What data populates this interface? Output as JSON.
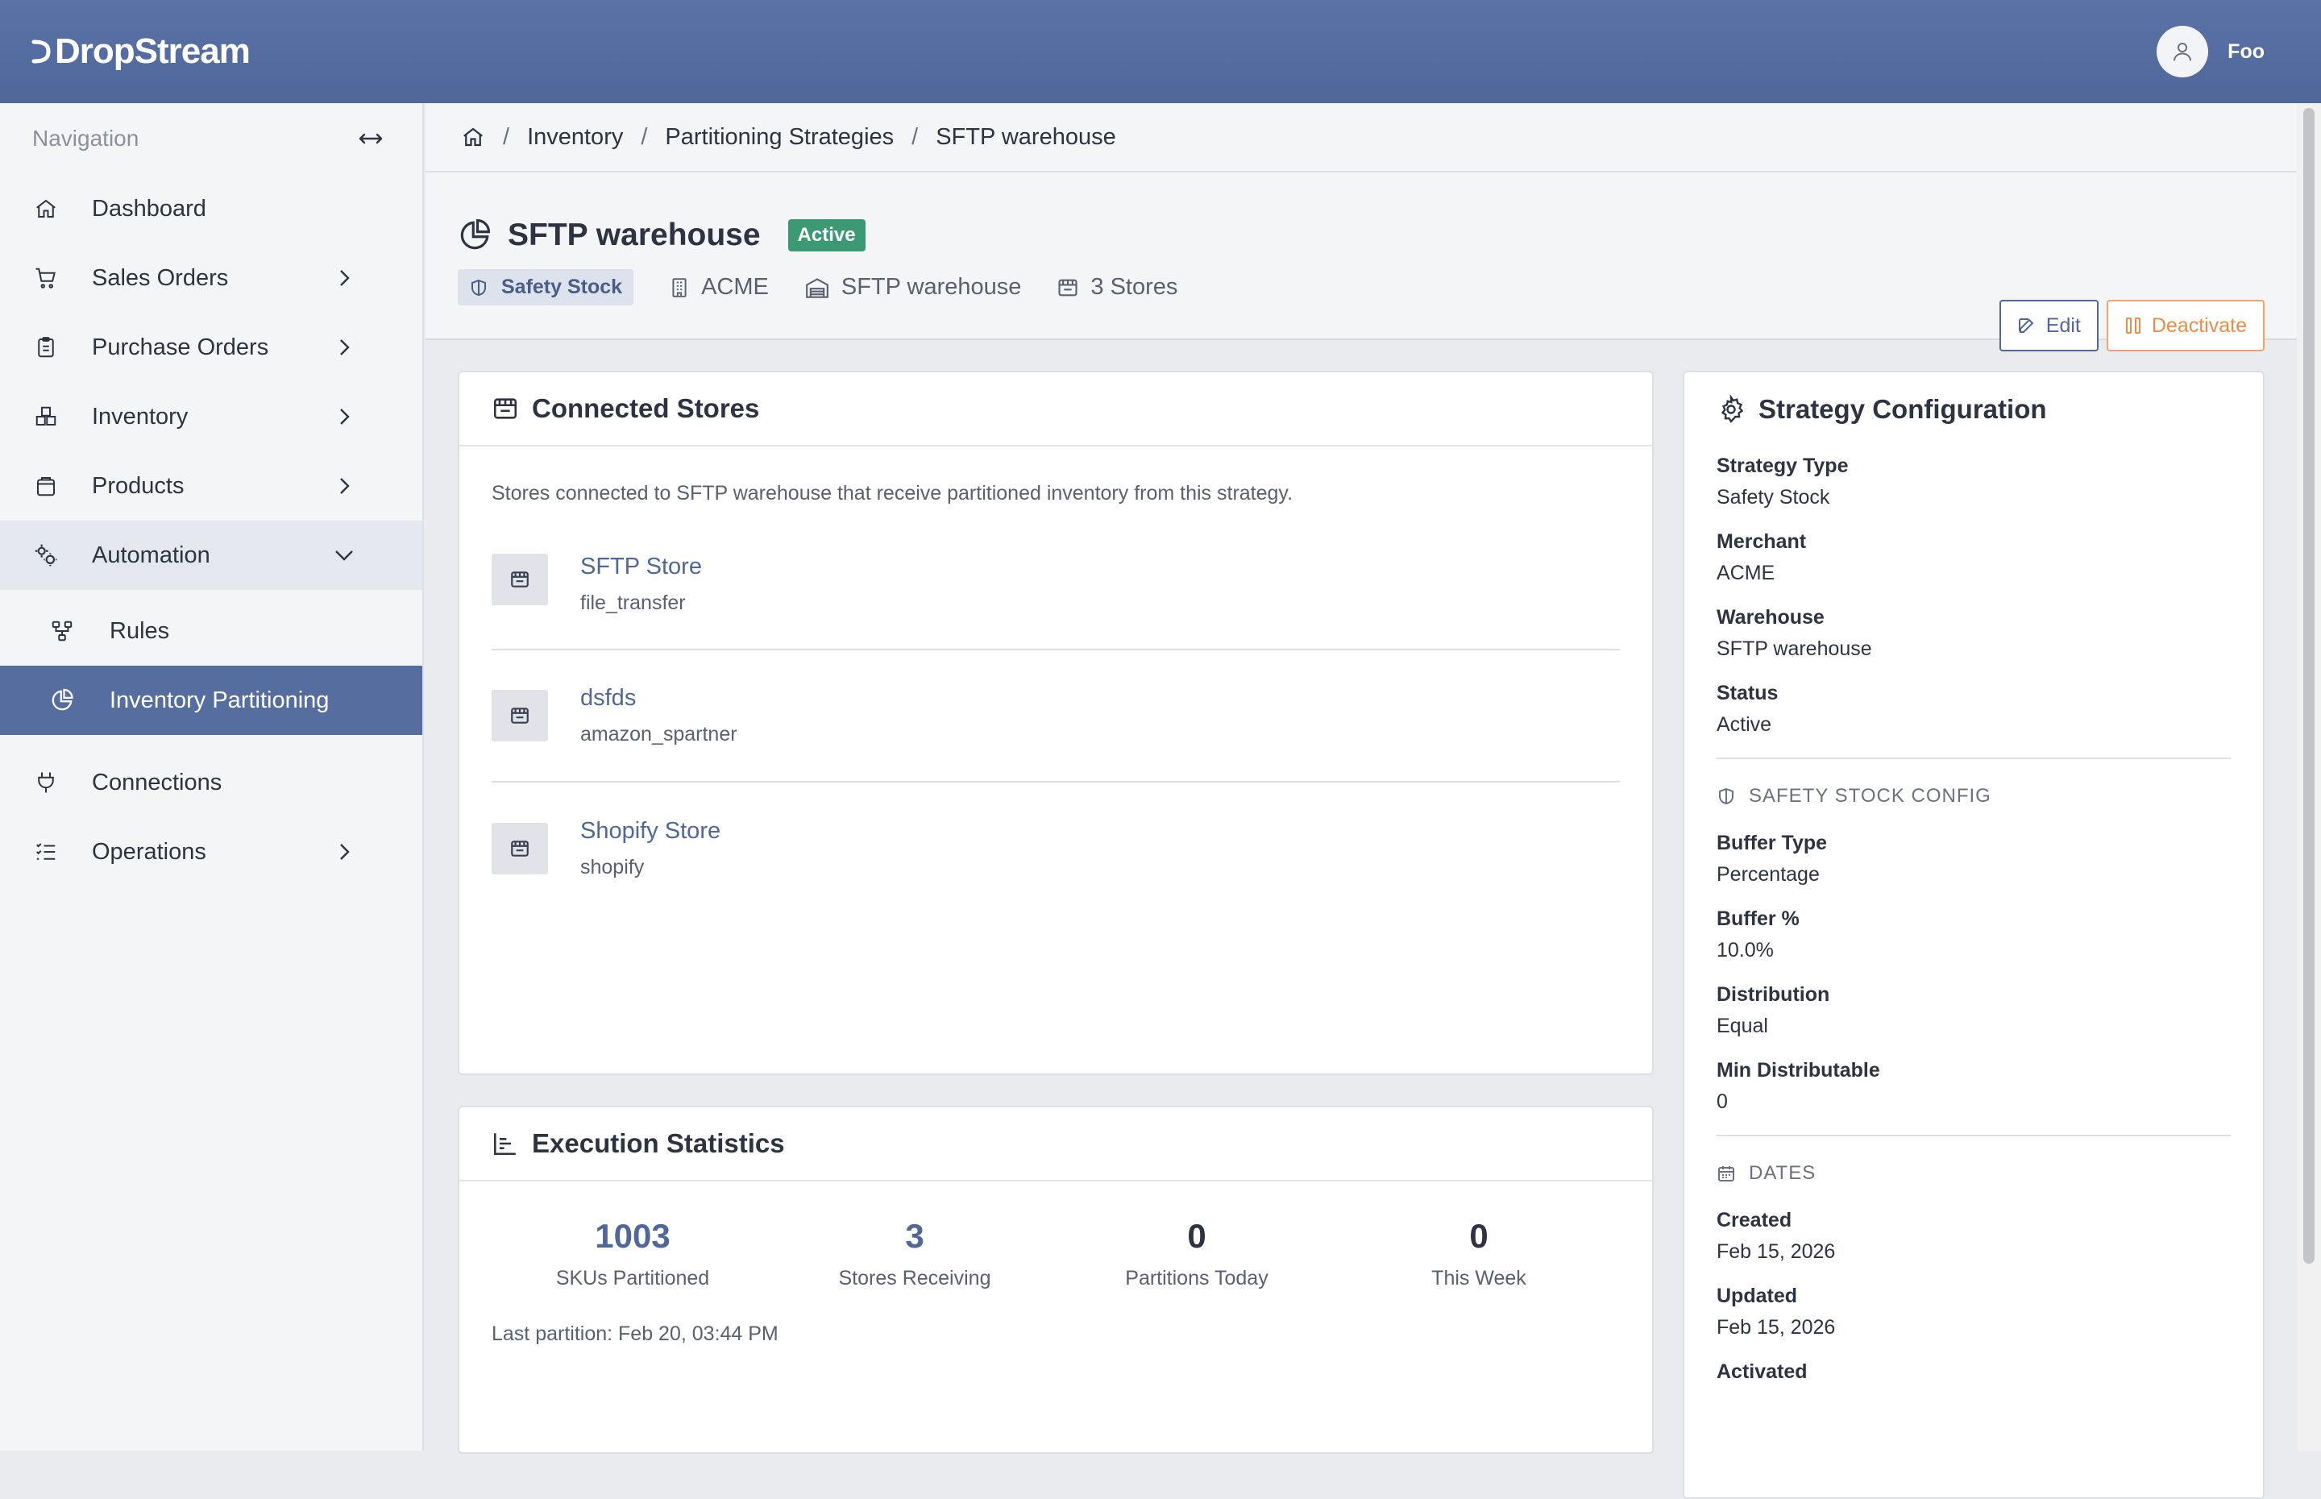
{
  "app": {
    "name": "DropStream"
  },
  "user": {
    "name": "Foo"
  },
  "sidebar": {
    "title": "Navigation",
    "items": [
      {
        "label": "Dashboard"
      },
      {
        "label": "Sales Orders"
      },
      {
        "label": "Purchase Orders"
      },
      {
        "label": "Inventory"
      },
      {
        "label": "Products"
      },
      {
        "label": "Automation"
      },
      {
        "label": "Connections"
      },
      {
        "label": "Operations"
      }
    ],
    "automation_children": [
      {
        "label": "Rules"
      },
      {
        "label": "Inventory Partitioning"
      }
    ]
  },
  "breadcrumb": [
    "Inventory",
    "Partitioning Strategies",
    "SFTP warehouse"
  ],
  "header": {
    "title": "SFTP warehouse",
    "status": "Active",
    "tag": "Safety Stock",
    "merchant": "ACME",
    "warehouse": "SFTP warehouse",
    "stores": "3 Stores",
    "edit_label": "Edit",
    "deactivate_label": "Deactivate"
  },
  "connected_stores": {
    "title": "Connected Stores",
    "description": "Stores connected to SFTP warehouse that receive partitioned inventory from this strategy.",
    "stores": [
      {
        "name": "SFTP Store",
        "type": "file_transfer"
      },
      {
        "name": "dsfds",
        "type": "amazon_spartner"
      },
      {
        "name": "Shopify Store",
        "type": "shopify"
      }
    ]
  },
  "stats": {
    "title": "Execution Statistics",
    "items": [
      {
        "value": "1003",
        "label": "SKUs Partitioned"
      },
      {
        "value": "3",
        "label": "Stores Receiving"
      },
      {
        "value": "0",
        "label": "Partitions Today"
      },
      {
        "value": "0",
        "label": "This Week"
      }
    ],
    "last_partition": "Last partition: Feb 20, 03:44 PM"
  },
  "config": {
    "title": "Strategy Configuration",
    "fields": [
      {
        "label": "Strategy Type",
        "value": "Safety Stock"
      },
      {
        "label": "Merchant",
        "value": "ACME"
      },
      {
        "label": "Warehouse",
        "value": "SFTP warehouse"
      },
      {
        "label": "Status",
        "value": "Active"
      }
    ],
    "safety_section": "SAFETY STOCK CONFIG",
    "safety_fields": [
      {
        "label": "Buffer Type",
        "value": "Percentage"
      },
      {
        "label": "Buffer %",
        "value": "10.0%"
      },
      {
        "label": "Distribution",
        "value": "Equal"
      },
      {
        "label": "Min Distributable",
        "value": "0"
      }
    ],
    "dates_section": "DATES",
    "date_fields": [
      {
        "label": "Created",
        "value": "Feb 15, 2026"
      },
      {
        "label": "Updated",
        "value": "Feb 15, 2026"
      },
      {
        "label": "Activated",
        "value": ""
      }
    ]
  },
  "colors": {
    "topbar": "#5a72a6",
    "accent": "#4f6799",
    "active_badge": "#3b9a73",
    "deactivate": "#ec8c45"
  }
}
